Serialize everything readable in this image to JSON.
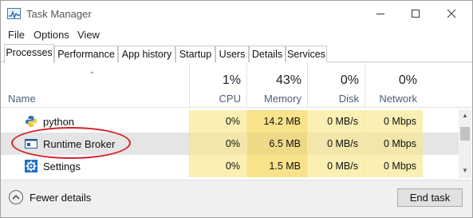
{
  "window": {
    "title": "Task Manager"
  },
  "menu": [
    "File",
    "Options",
    "View"
  ],
  "tabs": [
    {
      "label": "Processes",
      "active": true
    },
    {
      "label": "Performance",
      "active": false
    },
    {
      "label": "App history",
      "active": false
    },
    {
      "label": "Startup",
      "active": false
    },
    {
      "label": "Users",
      "active": false
    },
    {
      "label": "Details",
      "active": false
    },
    {
      "label": "Services",
      "active": false
    }
  ],
  "columns": {
    "name": "Name",
    "cpu": {
      "percent": "1%",
      "label": "CPU"
    },
    "memory": {
      "percent": "43%",
      "label": "Memory"
    },
    "disk": {
      "percent": "0%",
      "label": "Disk"
    },
    "network": {
      "percent": "0%",
      "label": "Network"
    }
  },
  "processes": [
    {
      "name": "python",
      "icon": "python-icon",
      "cpu": "0%",
      "memory": "14.2 MB",
      "disk": "0 MB/s",
      "network": "0 Mbps",
      "selected": false
    },
    {
      "name": "Runtime Broker",
      "icon": "runtime-broker-icon",
      "cpu": "0%",
      "memory": "6.5 MB",
      "disk": "0 MB/s",
      "network": "0 Mbps",
      "selected": true
    },
    {
      "name": "Settings",
      "icon": "settings-gear-icon",
      "cpu": "0%",
      "memory": "1.5 MB",
      "disk": "0 MB/s",
      "network": "0 Mbps",
      "selected": false
    }
  ],
  "footer": {
    "fewer_details": "Fewer details",
    "end_task": "End task"
  },
  "colors": {
    "cpu_heat": "#fbf0b3",
    "memory_heat": "#f8e38a",
    "selection": "#e5e5e5",
    "annotation": "#d6202a",
    "header_label": "#4c607a"
  }
}
